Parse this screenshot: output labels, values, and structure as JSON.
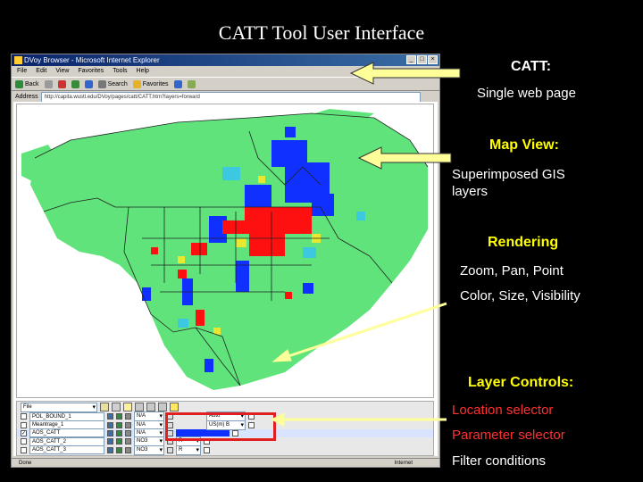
{
  "slide": {
    "title": "CATT Tool User Interface"
  },
  "browser": {
    "window_title": "DVoy Browser - Microsoft Internet Explorer",
    "menu": [
      "File",
      "Edit",
      "View",
      "Favorites",
      "Tools",
      "Help"
    ],
    "toolbar": {
      "back_label": "Back",
      "search_label": "Search",
      "favorites_label": "Favorites"
    },
    "address_label": "Address",
    "address_value": "http://capita.wustl.edu/DVoy/pages/catt/CATT.htm?layers=forward",
    "status_text": "Done",
    "status_zone": "Internet"
  },
  "controls": {
    "top_select": "File",
    "layers": [
      {
        "checked": false,
        "name": "POL_BOUND_1",
        "param": "N/A",
        "filter": "Auto"
      },
      {
        "checked": false,
        "name": "Meantrage_1",
        "param": "N/A",
        "filter": "US(m) B"
      },
      {
        "checked": true,
        "name": "AOS_CATT",
        "param": "N/A",
        "filter": ""
      },
      {
        "checked": false,
        "name": "AOS_CATT_2",
        "param": "NO3",
        "filter": "R"
      },
      {
        "checked": false,
        "name": "AOS_CATT_3",
        "param": "NO3",
        "filter": "R"
      }
    ]
  },
  "annotations": {
    "catt_heading": "CATT:",
    "catt_desc": "Single web page",
    "map_heading": "Map View:",
    "map_desc": "Superimposed GIS layers",
    "render_heading": "Rendering",
    "render_line1": "Zoom, Pan, Point",
    "render_line2": "Color, Size, Visibility",
    "layer_heading": "Layer Controls:",
    "layer_line1": "Location selector",
    "layer_line2": "Parameter selector",
    "layer_line3": "Filter conditions"
  },
  "colors": {
    "arrow": "#ffff66",
    "heading": "#ffff00",
    "selector_text": "#ff3030",
    "map_land": "#5fe37a",
    "map_high": "#ff1010",
    "map_low": "#1030ff"
  }
}
